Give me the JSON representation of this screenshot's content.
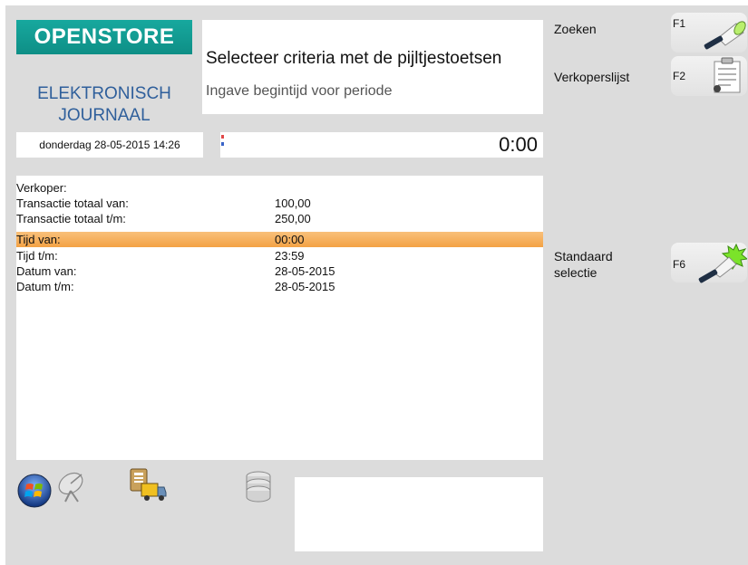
{
  "header": {
    "brand": "OPENSTORE",
    "title_line1": "ELEKTRONISCH",
    "title_line2": "JOURNAAL"
  },
  "prompt": {
    "title": "Selecteer criteria met de pijltjestoetsen",
    "subtitle": "Ingave begintijd voor periode"
  },
  "status_bar": {
    "datetime": "donderdag 28-05-2015 14:26",
    "timer": "0:00"
  },
  "criteria": {
    "rows": [
      {
        "label": "Verkoper:",
        "value": ""
      },
      {
        "label": "Transactie totaal van:",
        "value": "100,00"
      },
      {
        "label": "Transactie totaal t/m:",
        "value": "250,00"
      },
      {
        "label": "Tijd van:",
        "value": "00:00"
      },
      {
        "label": "Tijd t/m:",
        "value": "23:59"
      },
      {
        "label": "Datum van:",
        "value": "28-05-2015"
      },
      {
        "label": "Datum t/m:",
        "value": "28-05-2015"
      }
    ],
    "selected_row": "Tijd van:"
  },
  "function_keys": [
    {
      "label": "Zoeken",
      "key": "F1",
      "icon": "flashlight-icon"
    },
    {
      "label": "Verkoperslijst",
      "key": "F2",
      "icon": "clipboard-list-icon"
    },
    {
      "label_line1": "Standaard",
      "label_line2": "selectie",
      "key": "F6",
      "icon": "flashlight-burst-icon"
    }
  ],
  "bottom_icons": [
    "windows-icon",
    "satellite-dish-icon",
    "delivery-truck-icon",
    "database-icon"
  ],
  "colors": {
    "brand": "#14a096",
    "title": "#2f5f9b",
    "selected_row": "#f5a94e",
    "background": "#dcdcdc"
  }
}
